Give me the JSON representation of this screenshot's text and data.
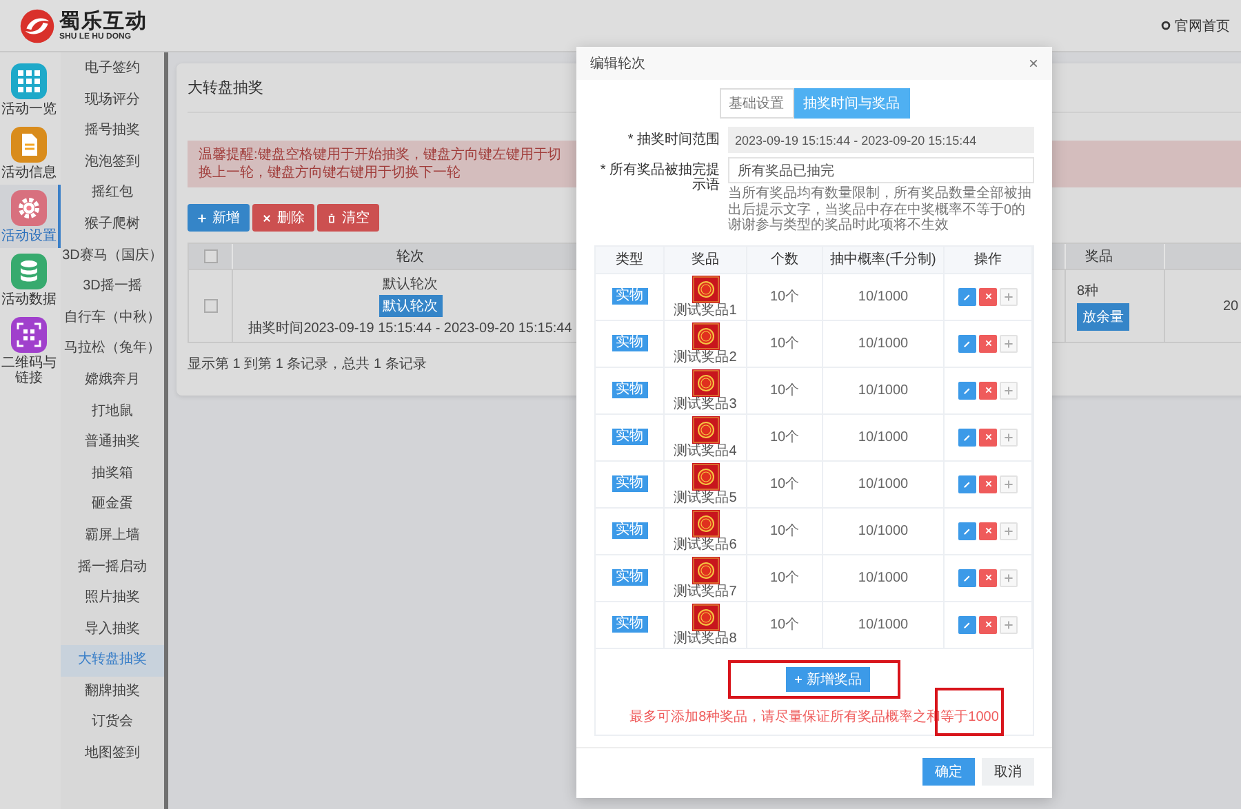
{
  "header": {
    "logo_title": "蜀乐互动",
    "logo_subtitle": "SHU LE HU DONG",
    "home_link": "官网首页"
  },
  "sidebar": {
    "items": [
      {
        "label": "活动一览",
        "kind": "grid",
        "color": "#1ea9c9",
        "selected": false
      },
      {
        "label": "活动信息",
        "kind": "document",
        "color": "#d98c1c",
        "selected": false
      },
      {
        "label": "活动设置",
        "kind": "gear",
        "color": "#d8707e",
        "selected": true
      },
      {
        "label": "活动数据",
        "kind": "database",
        "color": "#37aa6e",
        "selected": false
      },
      {
        "label": "二维码与链接",
        "kind": "qrcode",
        "color": "#a040cc",
        "selected": false
      }
    ]
  },
  "submenu": {
    "items": [
      {
        "label": "电子签约",
        "selected": false
      },
      {
        "label": "现场评分",
        "selected": false
      },
      {
        "label": "摇号抽奖",
        "selected": false
      },
      {
        "label": "泡泡签到",
        "selected": false
      },
      {
        "label": "摇红包",
        "selected": false
      },
      {
        "label": "猴子爬树",
        "selected": false
      },
      {
        "label": "3D赛马（国庆）",
        "selected": false
      },
      {
        "label": "3D摇一摇",
        "selected": false
      },
      {
        "label": "自行车（中秋）",
        "selected": false
      },
      {
        "label": "马拉松（兔年）",
        "selected": false
      },
      {
        "label": "嫦娥奔月",
        "selected": false
      },
      {
        "label": "打地鼠",
        "selected": false
      },
      {
        "label": "普通抽奖",
        "selected": false
      },
      {
        "label": "抽奖箱",
        "selected": false
      },
      {
        "label": "砸金蛋",
        "selected": false
      },
      {
        "label": "霸屏上墙",
        "selected": false
      },
      {
        "label": "摇一摇启动",
        "selected": false
      },
      {
        "label": "照片抽奖",
        "selected": false
      },
      {
        "label": "导入抽奖",
        "selected": false
      },
      {
        "label": "大转盘抽奖",
        "selected": true
      },
      {
        "label": "翻牌抽奖",
        "selected": false
      },
      {
        "label": "订货会",
        "selected": false
      },
      {
        "label": "地图签到",
        "selected": false
      }
    ]
  },
  "page": {
    "title": "大转盘抽奖",
    "alert": "温馨提醒:键盘空格键用于开始抽奖，键盘方向键左键用于切换上一轮，键盘方向键右键用于切换下一轮",
    "toolbar": [
      {
        "kind": "add",
        "label": "新增"
      },
      {
        "kind": "delete",
        "label": "删除"
      },
      {
        "kind": "clear",
        "label": "清空"
      }
    ],
    "table": {
      "header_checkbox": {
        "checked": false
      },
      "columns": [
        "轮次",
        "奖品"
      ],
      "rows": [
        {
          "checked": false,
          "name": "默认轮次",
          "badge": "默认轮次",
          "time": "抽奖时间2023-09-19 15:15:44 - 2023-09-20 15:15:44",
          "prize_count": "8种",
          "prize_button": "放余量",
          "column_5": "20"
        }
      ]
    },
    "footer": "显示第 1 到第 1 条记录，总共 1 条记录"
  },
  "modal": {
    "title": "编辑轮次",
    "close": "×",
    "tabs": [
      {
        "label": "基础设置",
        "selected": false
      },
      {
        "label": "抽奖时间与奖品",
        "selected": true
      }
    ],
    "fields": [
      {
        "mark": "*",
        "label": "抽奖时间范围",
        "value": "2023-09-19 15:15:44 - 2023-09-20 15:15:44",
        "disabled": true
      },
      {
        "mark": "*",
        "label": "所有奖品被抽完提示语",
        "value": "所有奖品已抽完",
        "disabled": false,
        "help": "当所有奖品均有数量限制，所有奖品数量全部被抽出后提示文字，当奖品中存在中奖概率不等于0的谢谢参与类型的奖品时此项将不生效"
      }
    ],
    "prize_table": {
      "columns": [
        "类型",
        "奖品",
        "个数",
        "抽中概率(千分制)",
        "操作"
      ],
      "rows": [
        {
          "type": "实物",
          "name": "测试奖品1",
          "count": "10个",
          "probability": "10/1000"
        },
        {
          "type": "实物",
          "name": "测试奖品2",
          "count": "10个",
          "probability": "10/1000"
        },
        {
          "type": "实物",
          "name": "测试奖品3",
          "count": "10个",
          "probability": "10/1000"
        },
        {
          "type": "实物",
          "name": "测试奖品4",
          "count": "10个",
          "probability": "10/1000"
        },
        {
          "type": "实物",
          "name": "测试奖品5",
          "count": "10个",
          "probability": "10/1000"
        },
        {
          "type": "实物",
          "name": "测试奖品6",
          "count": "10个",
          "probability": "10/1000"
        },
        {
          "type": "实物",
          "name": "测试奖品7",
          "count": "10个",
          "probability": "10/1000"
        },
        {
          "type": "实物",
          "name": "测试奖品8",
          "count": "10个",
          "probability": "10/1000"
        }
      ],
      "add_button": "新增奖品",
      "note": "最多可添加8种奖品，请尽量保证所有奖品概率之和等于1000"
    },
    "buttons": [
      {
        "kind": "primary",
        "label": "确定"
      },
      {
        "kind": "default",
        "label": "取消"
      }
    ]
  }
}
